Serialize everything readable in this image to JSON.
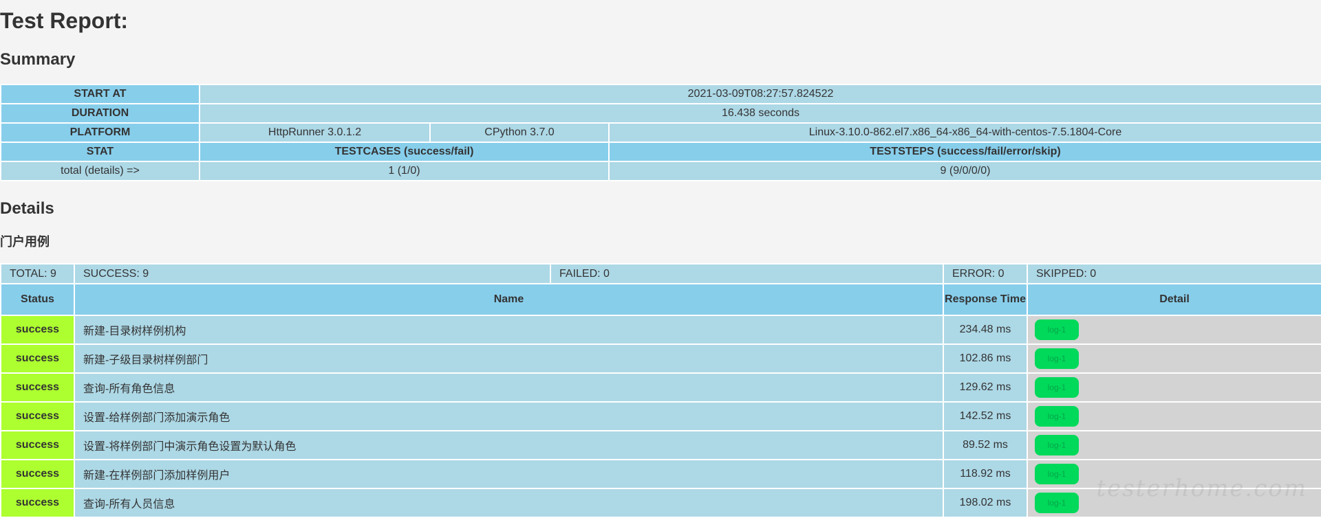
{
  "title": "Test Report:",
  "summary": {
    "heading": "Summary",
    "start_at_label": "START AT",
    "start_at_value": "2021-03-09T08:27:57.824522",
    "duration_label": "DURATION",
    "duration_value": "16.438 seconds",
    "platform_label": "PLATFORM",
    "platform_httprunner": "HttpRunner 3.0.1.2",
    "platform_python": "CPython 3.7.0",
    "platform_os": "Linux-3.10.0-862.el7.x86_64-x86_64-with-centos-7.5.1804-Core",
    "stat_label": "STAT",
    "testcases_label": "TESTCASES (success/fail)",
    "teststeps_label": "TESTSTEPS (success/fail/error/skip)",
    "total_label": "total (details) =>",
    "testcases_value": "1 (1/0)",
    "teststeps_value": "9 (9/0/0/0)"
  },
  "details": {
    "heading": "Details",
    "case_name": "门户用例",
    "totals": {
      "total": "TOTAL: 9",
      "success": "SUCCESS: 9",
      "failed": "FAILED: 0",
      "error": "ERROR: 0",
      "skipped": "SKIPPED: 0"
    },
    "columns": {
      "status": "Status",
      "name": "Name",
      "response_time": "Response Time",
      "detail": "Detail"
    },
    "rows": [
      {
        "status": "success",
        "name": "新建-目录树样例机构",
        "time": "234.48 ms",
        "log": "log-1"
      },
      {
        "status": "success",
        "name": "新建-子级目录树样例部门",
        "time": "102.86 ms",
        "log": "log-1"
      },
      {
        "status": "success",
        "name": "查询-所有角色信息",
        "time": "129.62 ms",
        "log": "log-1"
      },
      {
        "status": "success",
        "name": "设置-给样例部门添加演示角色",
        "time": "142.52 ms",
        "log": "log-1"
      },
      {
        "status": "success",
        "name": "设置-将样例部门中演示角色设置为默认角色",
        "time": "89.52 ms",
        "log": "log-1"
      },
      {
        "status": "success",
        "name": "新建-在样例部门添加样例用户",
        "time": "118.92 ms",
        "log": "log-1"
      },
      {
        "status": "success",
        "name": "查询-所有人员信息",
        "time": "198.02 ms",
        "log": "log-1"
      }
    ]
  },
  "watermark": "testerhome.com",
  "colors": {
    "header_blue": "#87ceeb",
    "cell_blue": "#add8e6",
    "success_green": "#adff2f",
    "log_button": "#00d95a",
    "detail_gray": "#d3d3d3"
  }
}
